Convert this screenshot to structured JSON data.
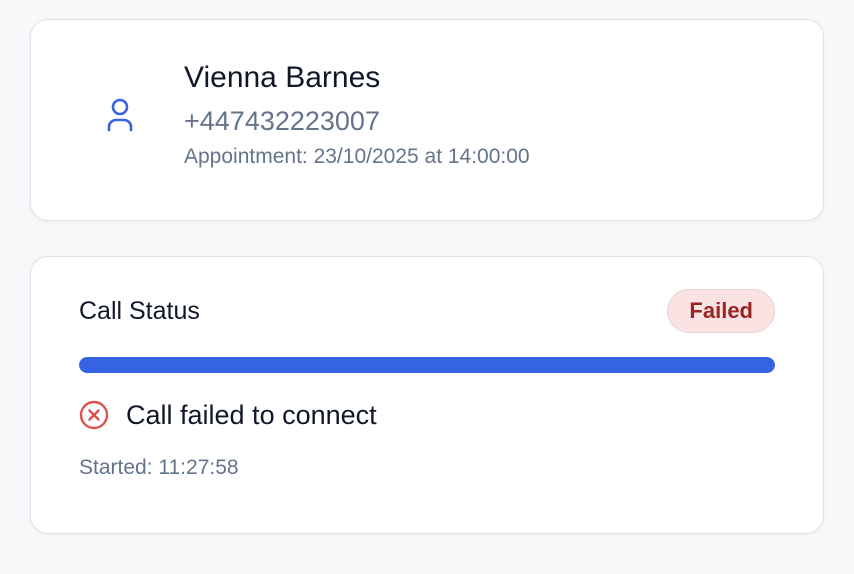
{
  "contact": {
    "name": "Vienna Barnes",
    "phone": "+447432223007",
    "appointment": "Appointment: 23/10/2025 at 14:00:00",
    "avatar_icon": "user-icon"
  },
  "call_status": {
    "title": "Call Status",
    "badge": "Failed",
    "progress": 1.0,
    "message": "Call failed to connect",
    "message_icon": "x-circle-icon",
    "started": "Started: 11:27:58"
  },
  "colors": {
    "accent": "#3563e3",
    "error": "#d9534f",
    "badge_bg": "#fbe3e3",
    "badge_text": "#9b2525",
    "muted_text": "#64748b"
  }
}
